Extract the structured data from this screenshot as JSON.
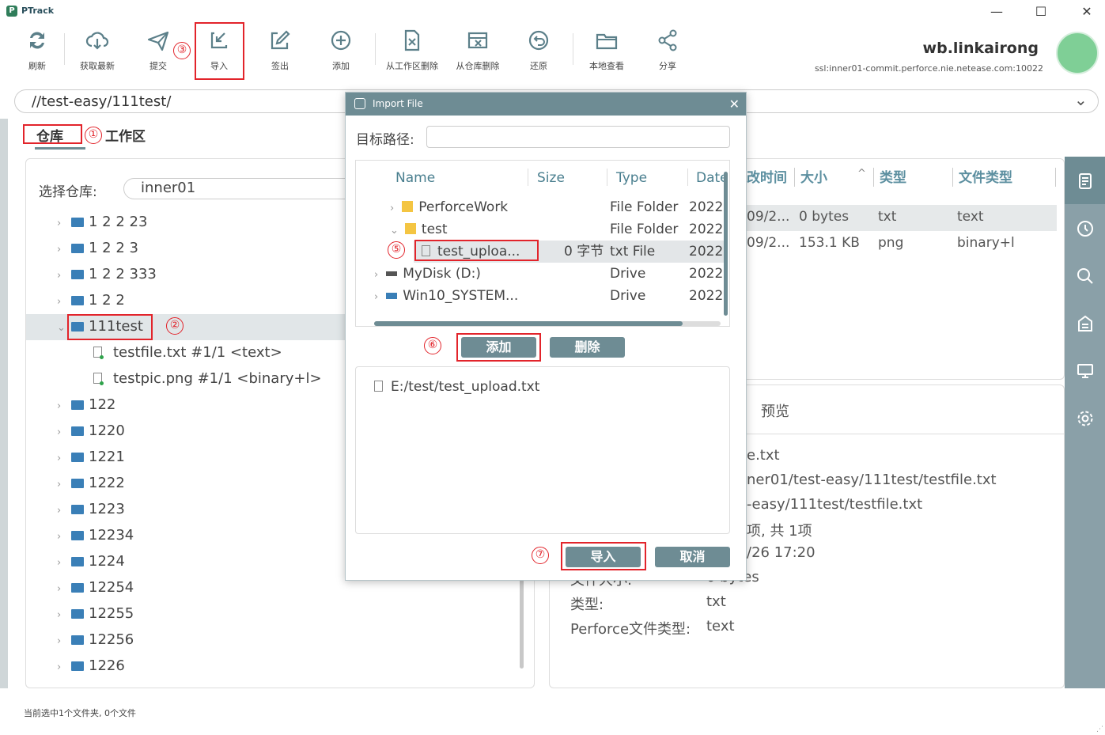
{
  "app": {
    "name": "PTrack",
    "win_minimize": "—",
    "win_maximize": "☐",
    "win_close": "✕"
  },
  "toolbar": {
    "refresh": "刷新",
    "get_latest": "获取最新",
    "submit": "提交",
    "import": "导入",
    "checkout": "签出",
    "add": "添加",
    "remove_workspace": "从工作区删除",
    "remove_depot": "从仓库删除",
    "revert": "还原",
    "local_view": "本地查看",
    "share": "分享"
  },
  "user": {
    "name": "wb.linkairong",
    "server": "ssl:inner01-commit.perforce.nie.netease.com:10022"
  },
  "path": {
    "value": "//test-easy/111test/",
    "dropdown": "⌄"
  },
  "tabs": {
    "depot": "仓库",
    "workspace": "工作区"
  },
  "markers": {
    "m1": "①",
    "m2": "②",
    "m3": "③",
    "m5": "⑤",
    "m6": "⑥",
    "m7": "⑦"
  },
  "depot_panel": {
    "select_label": "选择仓库:",
    "select_value": "inner01",
    "tree": [
      {
        "label": "1 2 2 23",
        "type": "folder"
      },
      {
        "label": "1 2 2 3",
        "type": "folder"
      },
      {
        "label": "1 2 2 333",
        "type": "folder"
      },
      {
        "label": "1 2 2",
        "type": "folder"
      },
      {
        "label": "111test",
        "type": "folder-open"
      },
      {
        "label": "testfile.txt  #1/1  <text>",
        "type": "file"
      },
      {
        "label": "testpic.png  #1/1  <binary+l>",
        "type": "file"
      },
      {
        "label": "122",
        "type": "folder"
      },
      {
        "label": "1220",
        "type": "folder"
      },
      {
        "label": "1221",
        "type": "folder"
      },
      {
        "label": "1222",
        "type": "folder"
      },
      {
        "label": "1223",
        "type": "folder"
      },
      {
        "label": "12234",
        "type": "folder"
      },
      {
        "label": "1224",
        "type": "folder"
      },
      {
        "label": "12254",
        "type": "folder"
      },
      {
        "label": "12255",
        "type": "folder"
      },
      {
        "label": "12256",
        "type": "folder"
      },
      {
        "label": "1226",
        "type": "folder"
      }
    ]
  },
  "file_table": {
    "headers": [
      "改时间",
      "大小",
      "^",
      "类型",
      "文件类型"
    ],
    "rows": [
      [
        "09/2...",
        "0 bytes",
        "txt",
        "text"
      ],
      [
        "09/2...",
        "153.1 KB",
        "png",
        "binary+l"
      ]
    ]
  },
  "preview_tab": "预览",
  "details": {
    "lines": [
      "e.txt",
      "ner01/test-easy/111test/testfile.txt",
      "-easy/111test/testfile.txt",
      "项, 共 1项",
      "/26 17:20"
    ],
    "size_label": "文件大小:",
    "size_value": "0 bytes",
    "type_label": "类型:",
    "type_value": "txt",
    "ptype_label": "Perforce文件类型:",
    "ptype_value": "text"
  },
  "status": "当前选中1个文件夹, 0个文件",
  "dialog": {
    "title": "Import File",
    "close": "✕",
    "target_label": "目标路径:",
    "target_value": "",
    "columns": [
      "Name",
      "Size",
      "Type",
      "Date"
    ],
    "rows": [
      {
        "name": "PerforceWork",
        "size": "",
        "type": "File Folder",
        "date": "2022"
      },
      {
        "name": "test",
        "size": "",
        "type": "File Folder",
        "date": "2022"
      },
      {
        "name": "test_uploa...",
        "size": "0 字节",
        "type": "txt File",
        "date": "2022"
      },
      {
        "name": "MyDisk (D:)",
        "size": "",
        "type": "Drive",
        "date": "2022"
      },
      {
        "name": "Win10_SYSTEM...",
        "size": "",
        "type": "Drive",
        "date": "2022"
      }
    ],
    "add_btn": "添加",
    "delete_btn": "删除",
    "list": [
      "E:/test/test_upload.txt"
    ],
    "import_btn": "导入",
    "cancel_btn": "取消"
  },
  "colors": {
    "accent": "#6e8c94",
    "red": "#e2242b",
    "folder": "#3a7fb7",
    "sidebar": "#8aa0a8"
  }
}
